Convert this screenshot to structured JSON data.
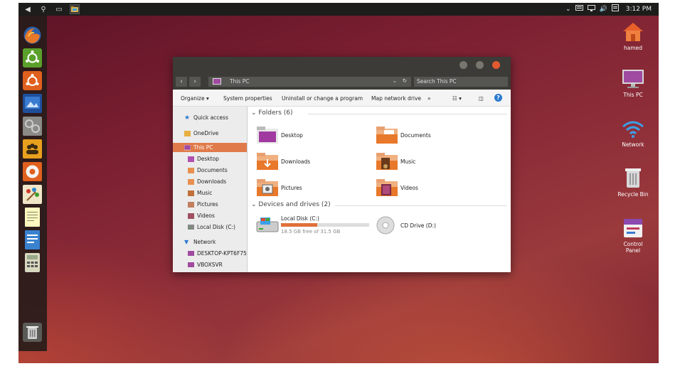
{
  "topbar": {
    "time": "3:12 PM",
    "left_icons": [
      "back-icon",
      "search-icon",
      "multitask-icon",
      "file-explorer-icon"
    ],
    "tray_icons": [
      "chevron-down-icon",
      "keyboard-icon",
      "network-icon",
      "volume-icon",
      "notification-icon"
    ]
  },
  "launcher": {
    "items": [
      "firefox",
      "ubuntu-settings",
      "ubuntu-software",
      "image-viewer",
      "settings",
      "contacts",
      "help",
      "paint",
      "notepad",
      "writer",
      "calculator"
    ],
    "trash": "trash"
  },
  "desktop": {
    "icons": [
      {
        "label": "hamed",
        "icon": "home-folder-icon"
      },
      {
        "label": "This PC",
        "icon": "computer-icon"
      },
      {
        "label": "Network",
        "icon": "wifi-icon"
      },
      {
        "label": "Recycle Bin",
        "icon": "recycle-bin-icon"
      },
      {
        "label": "Control Panel",
        "icon": "control-panel-icon"
      }
    ]
  },
  "explorer": {
    "address": "This PC",
    "search_placeholder": "Search This PC",
    "ribbon": {
      "organize": "Organize ▾",
      "system_properties": "System properties",
      "uninstall": "Uninstall or change a program",
      "map_drive": "Map network drive",
      "more": "»"
    },
    "nav": {
      "quick_access": "Quick access",
      "onedrive": "OneDrive",
      "this_pc": "This PC",
      "this_pc_children": [
        "Desktop",
        "Documents",
        "Downloads",
        "Music",
        "Pictures",
        "Videos",
        "Local Disk (C:)"
      ],
      "network": "Network",
      "network_children": [
        "DESKTOP-KPT6F75",
        "VBOXSVR"
      ]
    },
    "folders_heading": "Folders (6)",
    "folders": [
      "Desktop",
      "Documents",
      "Downloads",
      "Music",
      "Pictures",
      "Videos"
    ],
    "devices_heading": "Devices and drives (2)",
    "drives": [
      {
        "name": "Local Disk (C:)",
        "free_text": "18.5 GB free of 31.5 GB",
        "used_fraction": 0.41
      },
      {
        "name": "CD Drive (D:)"
      }
    ],
    "colors": {
      "accent": "#e07a4a",
      "titlebar": "#3c3b37"
    }
  }
}
